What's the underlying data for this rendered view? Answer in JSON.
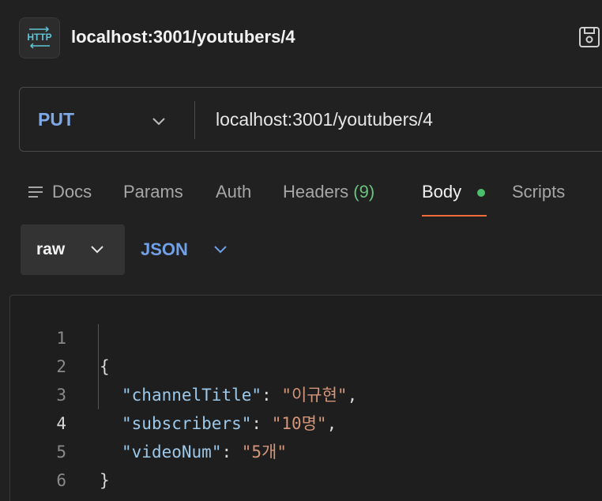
{
  "header": {
    "icon": "http-icon",
    "title": "localhost:3001/youtubers/4",
    "save_icon": "save-icon"
  },
  "request": {
    "method": "PUT",
    "url": "localhost:3001/youtubers/4"
  },
  "tabs": [
    {
      "label": "Docs",
      "icon": "docs-icon"
    },
    {
      "label": "Params"
    },
    {
      "label": "Auth"
    },
    {
      "label": "Headers",
      "count": "(9)"
    },
    {
      "label": "Body",
      "active": true,
      "indicator_color": "#4bbf6b"
    },
    {
      "label": "Scripts"
    }
  ],
  "body": {
    "mode": "raw",
    "language": "JSON"
  },
  "editor": {
    "lines": [
      {
        "num": "1",
        "open": "{"
      },
      {
        "num": "2",
        "q1": "\"",
        "key": "channelTitle",
        "q2": "\"",
        "colon": ": ",
        "value": "\"이규현\"",
        "comma": ","
      },
      {
        "num": "3",
        "q1": "\"",
        "key": "subscribers",
        "q2": "\"",
        "colon": ": ",
        "value": "\"10명\"",
        "comma": ","
      },
      {
        "num": "4",
        "q1": "\"",
        "key": "videoNum",
        "q2": "\"",
        "colon": ": ",
        "value": "\"5개\""
      },
      {
        "num": "5",
        "close": "}"
      },
      {
        "num": "6"
      }
    ]
  },
  "colors": {
    "accent_underline": "#f26b3a",
    "method": "#7fa8e6",
    "json_key": "#9cc8ea",
    "json_string": "#d4967a"
  }
}
